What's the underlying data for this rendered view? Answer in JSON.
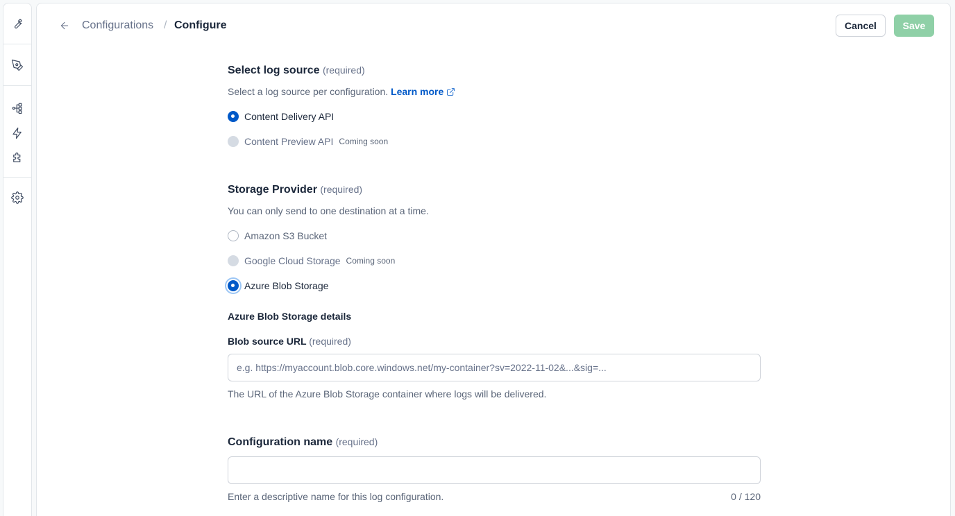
{
  "breadcrumb": {
    "parent": "Configurations",
    "separator": "/",
    "current": "Configure"
  },
  "actions": {
    "cancel": "Cancel",
    "save": "Save"
  },
  "log_source": {
    "title": "Select log source",
    "required": "(required)",
    "help": "Select a log source per configuration.",
    "learn_more": "Learn more",
    "options": [
      {
        "label": "Content Delivery API",
        "selected": true
      },
      {
        "label": "Content Preview API",
        "badge": "Coming soon",
        "disabled": true
      }
    ]
  },
  "storage": {
    "title": "Storage Provider",
    "required": "(required)",
    "help": "You can only send to one destination at a time.",
    "options": [
      {
        "label": "Amazon S3 Bucket"
      },
      {
        "label": "Google Cloud Storage",
        "badge": "Coming soon",
        "disabled": true
      },
      {
        "label": "Azure Blob Storage",
        "selected": true
      }
    ]
  },
  "azure": {
    "details_title": "Azure Blob Storage details",
    "url_label": "Blob source URL",
    "url_required": "(required)",
    "url_placeholder": "e.g. https://myaccount.blob.core.windows.net/my-container?sv=2022-11-02&...&sig=...",
    "url_help": "The URL of the Azure Blob Storage container where logs will be delivered."
  },
  "config_name": {
    "title": "Configuration name",
    "required": "(required)",
    "value": "",
    "help": "Enter a descriptive name for this log configuration.",
    "counter": "0 / 120"
  },
  "icons": [
    "wrench-icon",
    "pen-icon",
    "flow-icon",
    "bolt-icon",
    "puzzle-icon",
    "gear-icon",
    "arrow-left-icon",
    "external-link-icon"
  ],
  "colors": {
    "primary": "#0059c8",
    "save_disabled": "#8fd0a7"
  }
}
